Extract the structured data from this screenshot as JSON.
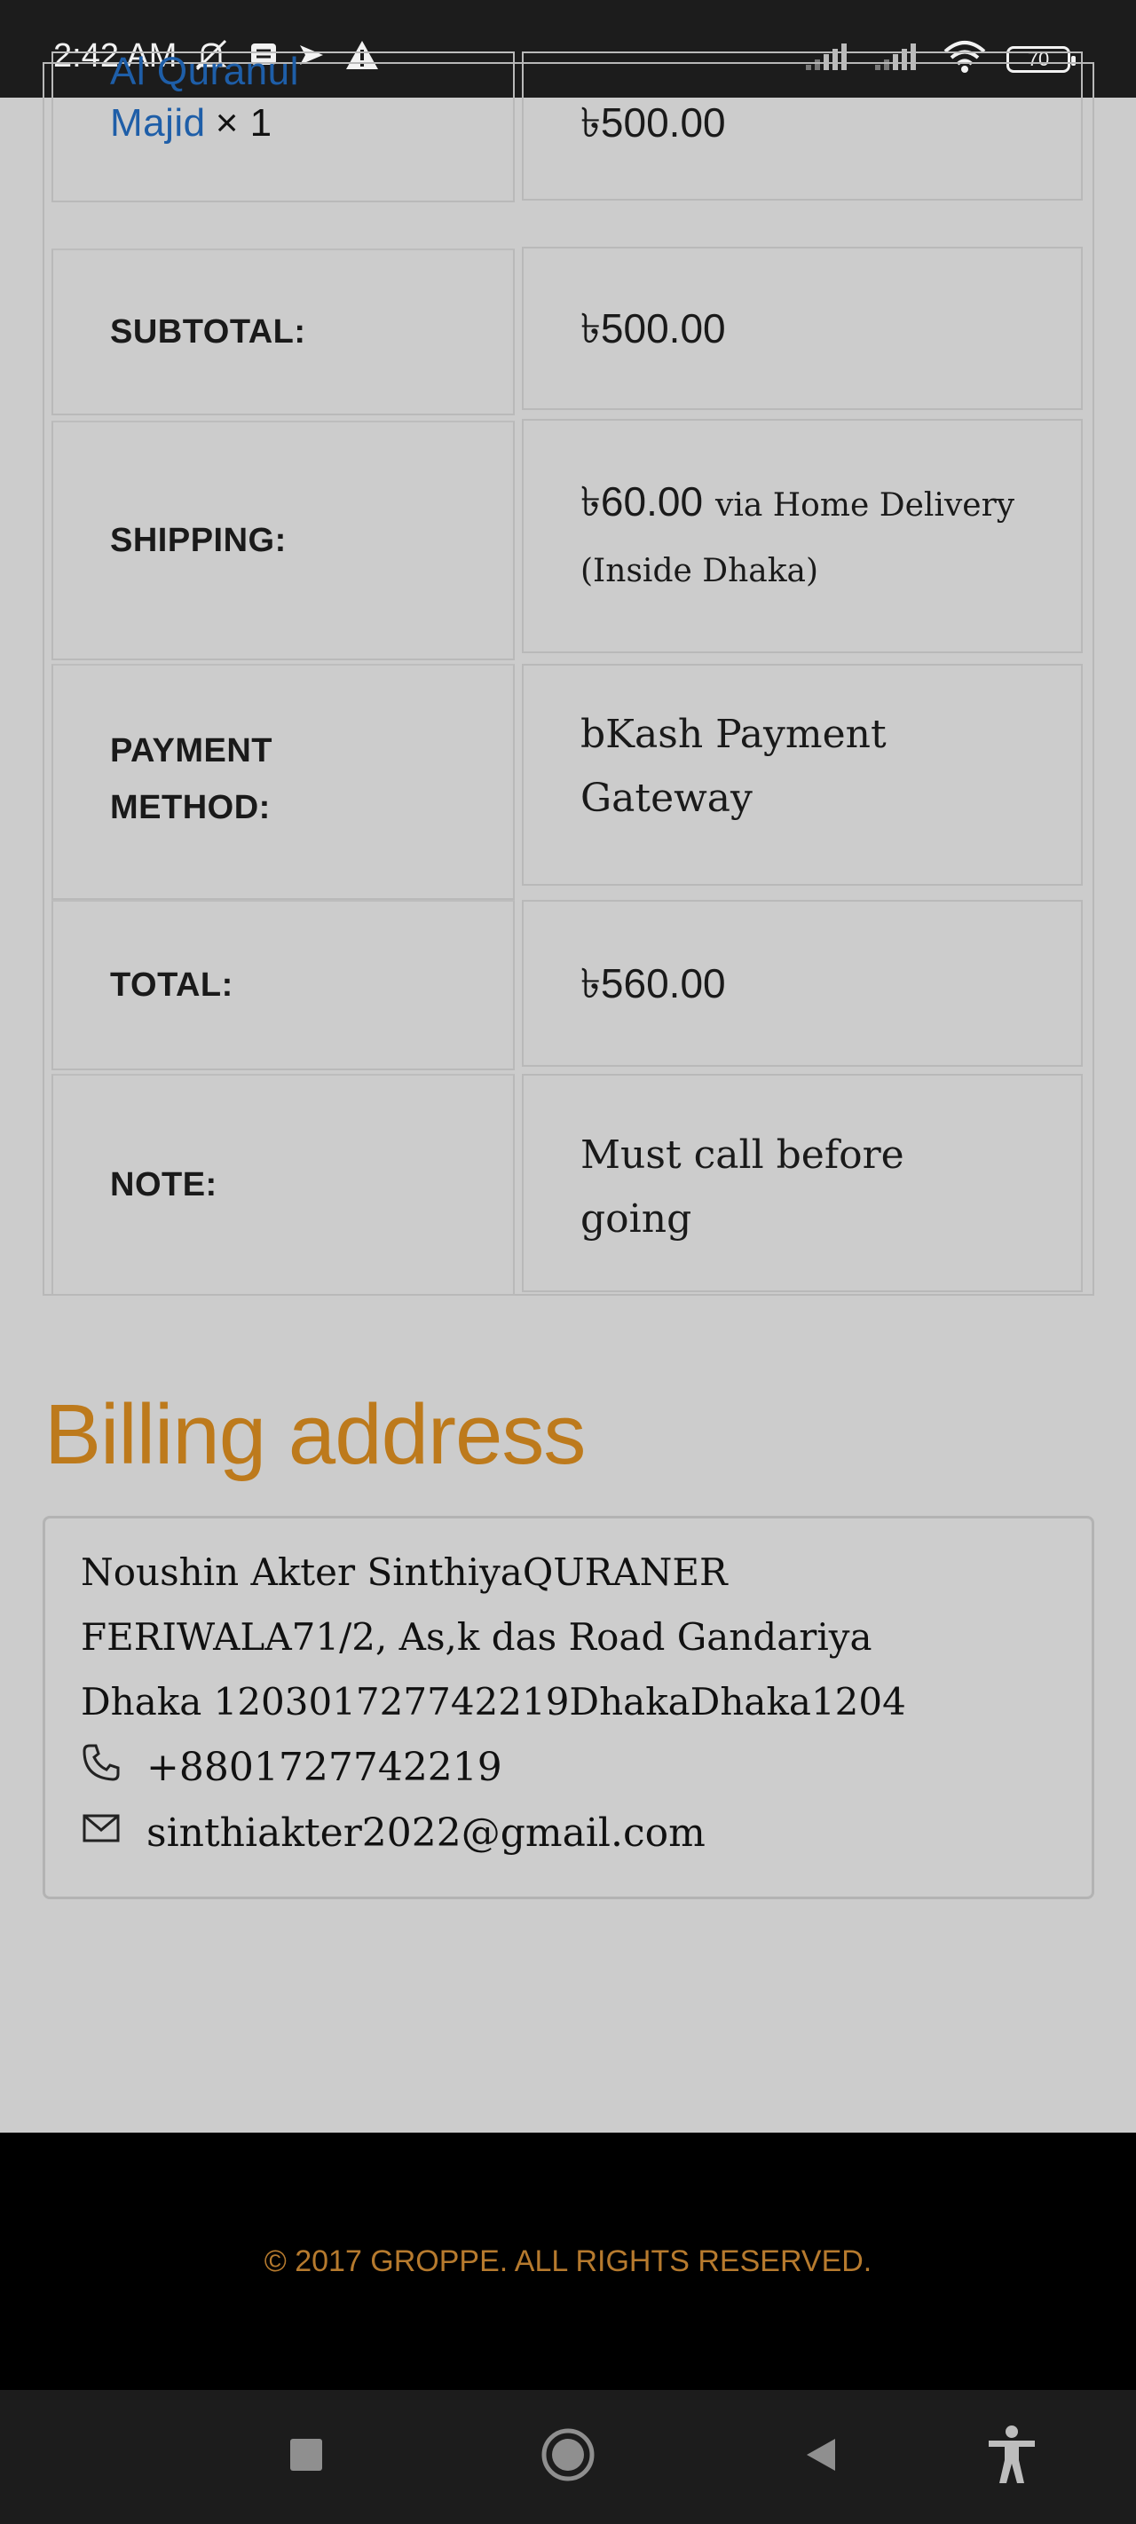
{
  "status_bar": {
    "time": "2:42 AM",
    "battery": "70",
    "icons": [
      "alarm-off-icon",
      "message-icon",
      "navigation-icon",
      "warning-icon",
      "signal-icon",
      "signal-icon",
      "wifi-icon",
      "battery-icon"
    ]
  },
  "order": {
    "product": {
      "name_line1": "Al Quranul",
      "name_line2": "Majid",
      "qty": "× 1",
      "price": "৳500.00"
    },
    "subtotal": {
      "label": "SUBTOTAL:",
      "value": "৳500.00"
    },
    "shipping": {
      "label": "SHIPPING:",
      "value": "৳60.00",
      "method_line1": "via Home Delivery",
      "method_line2": "(Inside Dhaka)"
    },
    "payment": {
      "label_line1": "PAYMENT",
      "label_line2": "METHOD:",
      "value_line1": "bKash Payment",
      "value_line2": "Gateway"
    },
    "total": {
      "label": "TOTAL:",
      "value": "৳560.00"
    },
    "note": {
      "label": "NOTE:",
      "value_line1": "Must call before",
      "value_line2": "going"
    }
  },
  "billing": {
    "title": "Billing address",
    "address_line1": "Noushin Akter SinthiyaQURANER",
    "address_line2": "FERIWALA71/2, As,k das Road Gandariya",
    "address_line3": "Dhaka 120301727742219DhakaDhaka1204",
    "phone": "+8801727742219",
    "email": "sinthiakter2022@gmail.com"
  },
  "footer": {
    "text": "© 2017 GROPPE. ALL RIGHTS RESERVED."
  },
  "colors": {
    "accent": "#bd7a1c",
    "link": "#1e5ea8",
    "footer_text": "#b67a2e",
    "page_bg": "#cccccc"
  }
}
